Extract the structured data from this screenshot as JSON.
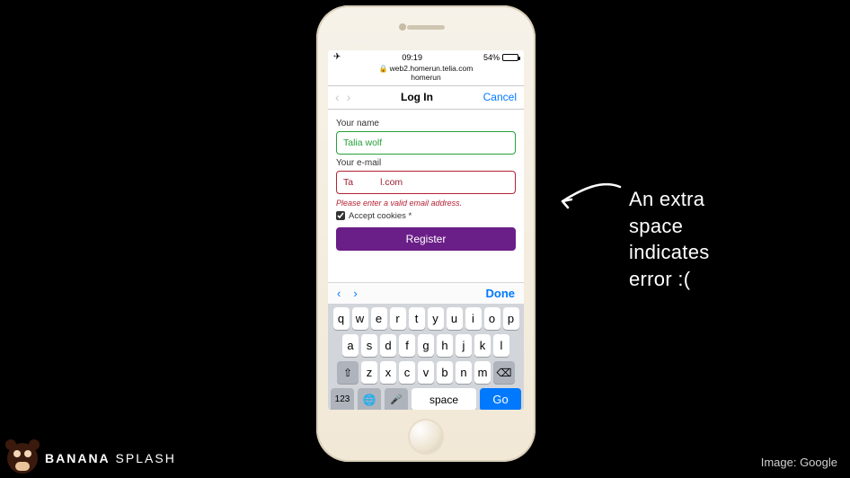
{
  "slide": {
    "annotation_text": "An extra space indicates error :(",
    "image_credit": "Image: Google",
    "brand_bold": "BANANA",
    "brand_light": " SPLASH"
  },
  "status": {
    "time": "09:19",
    "battery_pct": "54%"
  },
  "browser": {
    "host": "web2.homerun.telia.com",
    "path": "homerun"
  },
  "nav": {
    "title": "Log In",
    "cancel": "Cancel"
  },
  "form": {
    "name_label": "Your name",
    "name_value": "Talia wolf",
    "email_label": "Your e-mail",
    "email_value_left": "Ta",
    "email_value_right": "l.com",
    "email_error": "Please enter a valid email address.",
    "cookies_label": "Accept cookies *",
    "cookies_checked": true,
    "register_label": "Register"
  },
  "accessory": {
    "done": "Done"
  },
  "keyboard": {
    "row1": [
      "q",
      "w",
      "e",
      "r",
      "t",
      "y",
      "u",
      "i",
      "o",
      "p"
    ],
    "row2": [
      "a",
      "s",
      "d",
      "f",
      "g",
      "h",
      "j",
      "k",
      "l"
    ],
    "row3": [
      "z",
      "x",
      "c",
      "v",
      "b",
      "n",
      "m"
    ],
    "func_123": "123",
    "space": "space",
    "go": "Go"
  }
}
